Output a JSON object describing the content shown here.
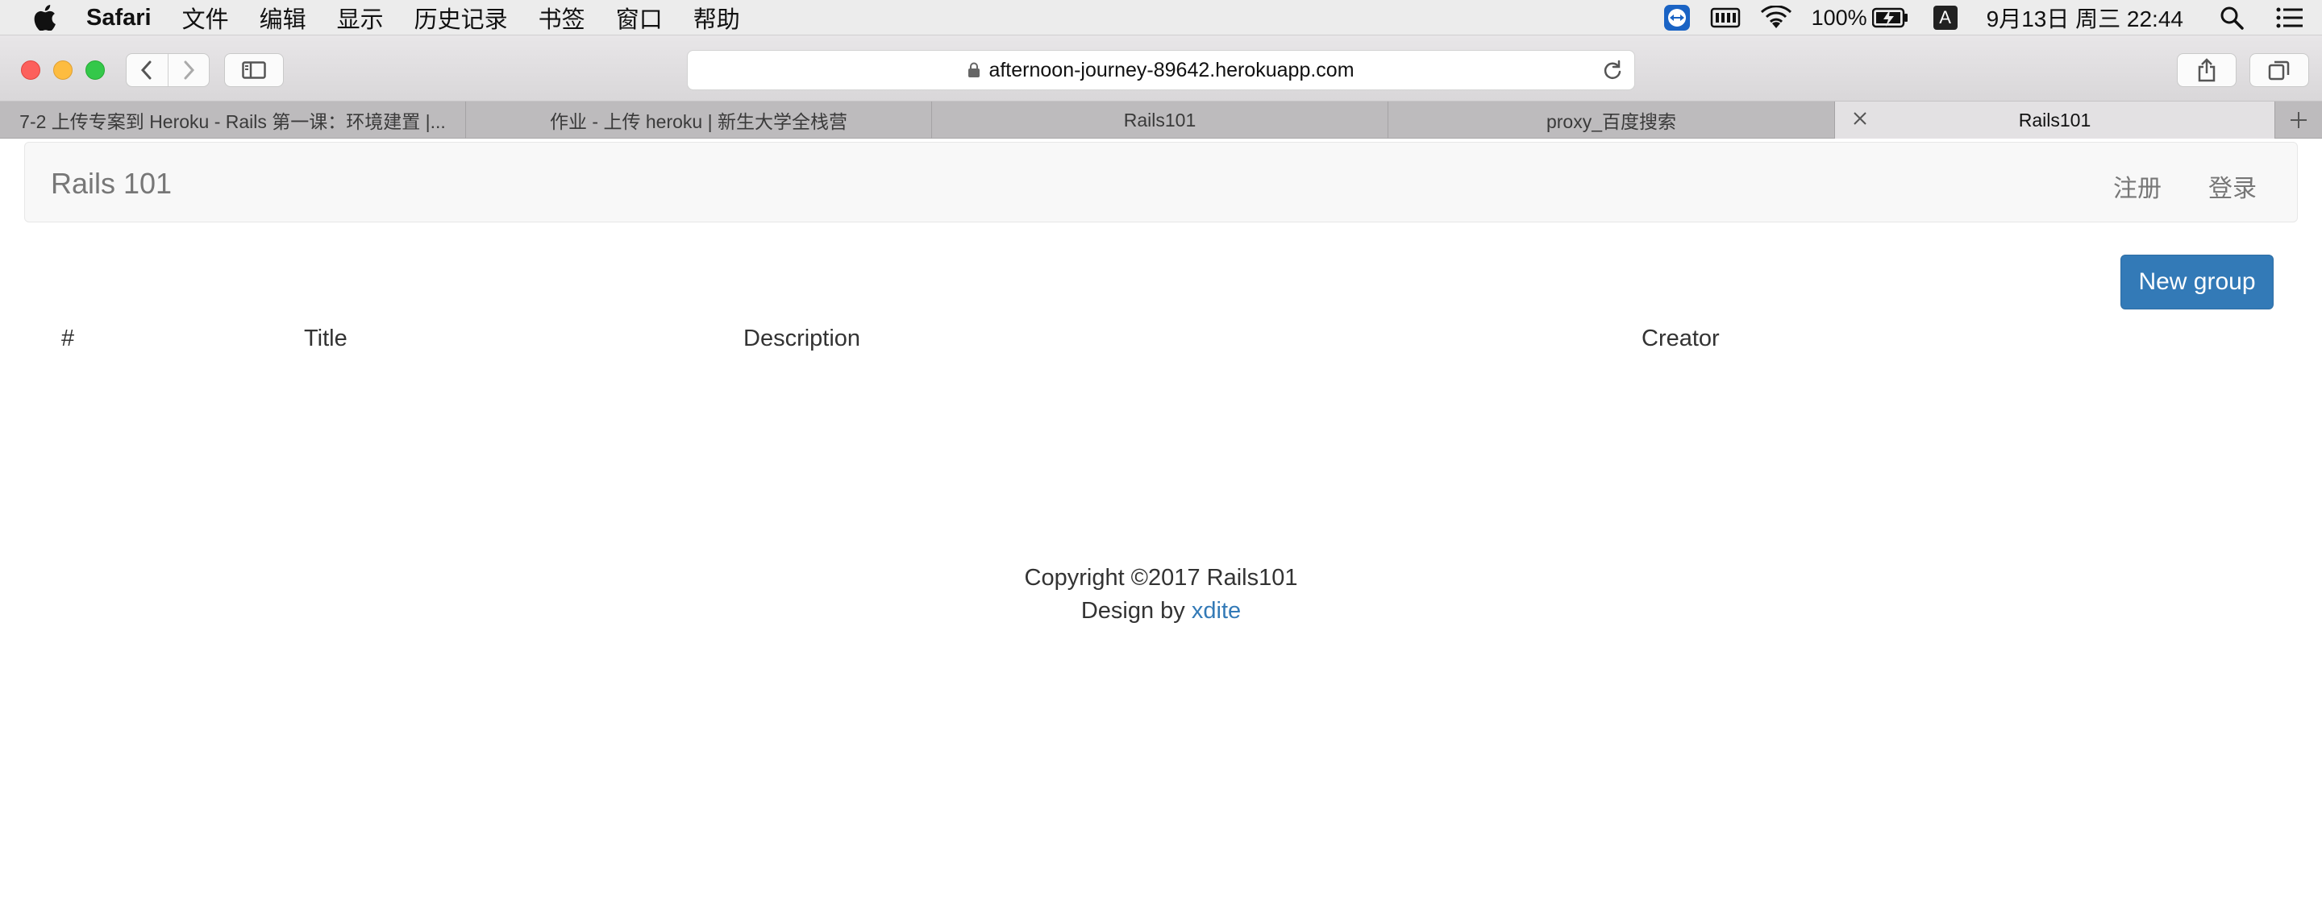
{
  "menubar": {
    "app_name": "Safari",
    "items": [
      "文件",
      "编辑",
      "显示",
      "历史记录",
      "书签",
      "窗口",
      "帮助"
    ],
    "battery": "100%",
    "input_method": "A",
    "clock": "9月13日 周三  22:44"
  },
  "browser": {
    "url": "afternoon-journey-89642.herokuapp.com",
    "tabs": [
      {
        "label": "7-2 上传专案到 Heroku - Rails 第一课：环境建置 |..."
      },
      {
        "label": "作业 - 上传 heroku | 新生大学全栈营"
      },
      {
        "label": "Rails101"
      },
      {
        "label": "proxy_百度搜索"
      },
      {
        "label": "Rails101"
      }
    ]
  },
  "site": {
    "brand": "Rails 101",
    "nav": {
      "signup": "注册",
      "login": "登录"
    },
    "new_group_label": "New group",
    "table_headers": {
      "num": "#",
      "title": "Title",
      "description": "Description",
      "creator": "Creator"
    },
    "footer": {
      "copyright": "Copyright ©2017 Rails101",
      "design_prefix": "Design by",
      "design_link": "xdite"
    },
    "link_color": "#337ab7"
  }
}
